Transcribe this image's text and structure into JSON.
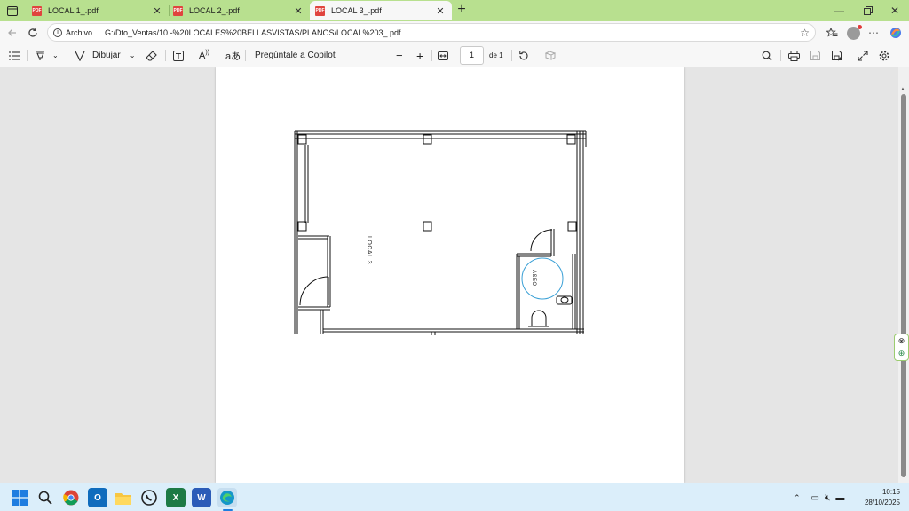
{
  "tabs": [
    {
      "label": "LOCAL 1_.pdf",
      "active": false
    },
    {
      "label": "LOCAL 2_.pdf",
      "active": false
    },
    {
      "label": "LOCAL 3_.pdf",
      "active": true
    }
  ],
  "address": {
    "scheme_label": "Archivo",
    "url": "G:/Dto_Ventas/10.-%20LOCALES%20BELLASVISTAS/PLANOS/LOCAL%203_.pdf"
  },
  "toolbar": {
    "draw_label": "Dibujar",
    "copilot_label": "Pregúntale a Copilot",
    "page_current": "1",
    "page_of": "de 1"
  },
  "plan": {
    "room_label": "LOCAL 3",
    "bath_label": "ASEO"
  },
  "clock": {
    "time": "10:15",
    "date": "28/10/2025"
  },
  "colors": {
    "accent": "#b8e08f",
    "taskbar": "#dbeefa",
    "annotation_circle": "#3aa0d6"
  }
}
